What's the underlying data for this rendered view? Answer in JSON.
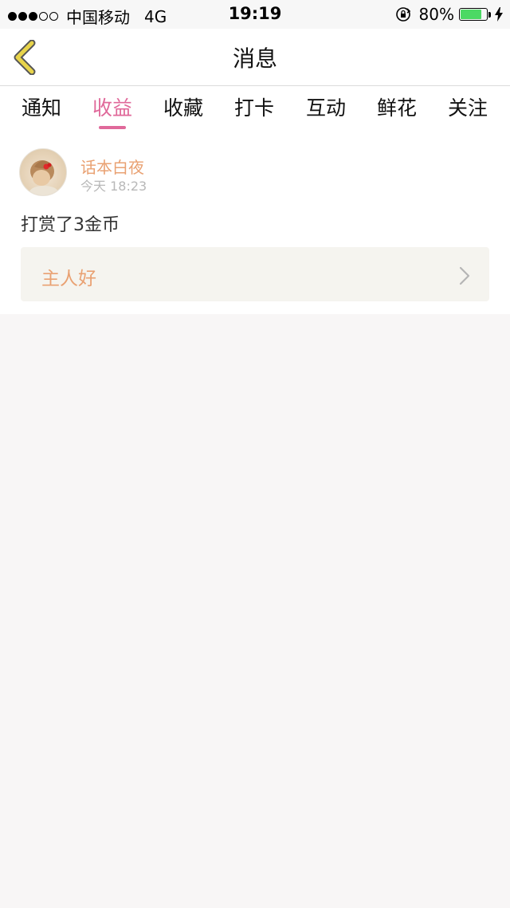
{
  "status_bar": {
    "carrier": "中国移动",
    "network": "4G",
    "time": "19:19",
    "battery_percent": "80%",
    "battery_level": 0.8,
    "signal_bars_filled": 3,
    "signal_bars_total": 5
  },
  "nav": {
    "title": "消息",
    "back_icon": "chevron-left-icon",
    "accent_color": "#e8d44a"
  },
  "tabs": [
    {
      "label": "通知",
      "active": false
    },
    {
      "label": "收益",
      "active": true
    },
    {
      "label": "收藏",
      "active": false
    },
    {
      "label": "打卡",
      "active": false
    },
    {
      "label": "互动",
      "active": false
    },
    {
      "label": "鲜花",
      "active": false
    },
    {
      "label": "关注",
      "active": false
    }
  ],
  "active_tab_color": "#e0699a",
  "message_card": {
    "username": "话本白夜",
    "timestamp": "今天 18:23",
    "content": "打赏了3金币",
    "quote": "主人好",
    "username_color": "#e9a172"
  }
}
